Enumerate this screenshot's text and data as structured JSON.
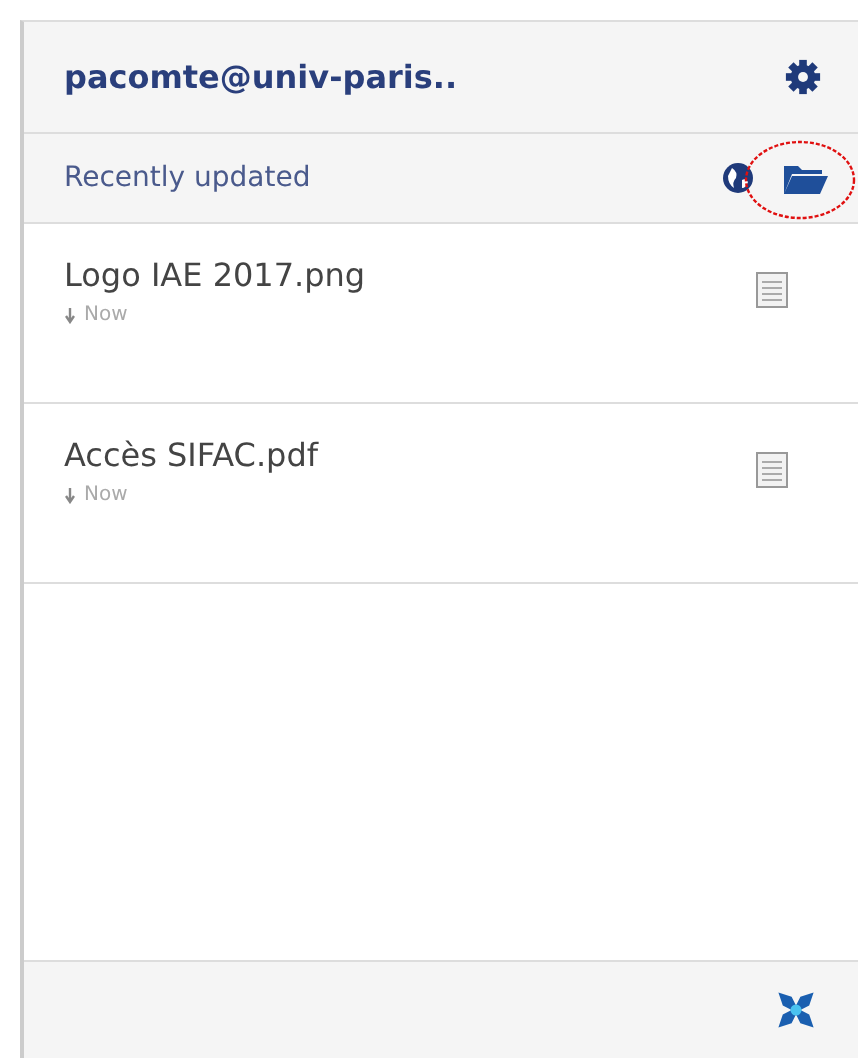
{
  "header": {
    "account": "pacomte@univ-paris.."
  },
  "subheader": {
    "title": "Recently updated"
  },
  "files": [
    {
      "name": "Logo IAE 2017.png",
      "time": "Now"
    },
    {
      "name": "Accès SIFAC.pdf",
      "time": "Now"
    }
  ]
}
